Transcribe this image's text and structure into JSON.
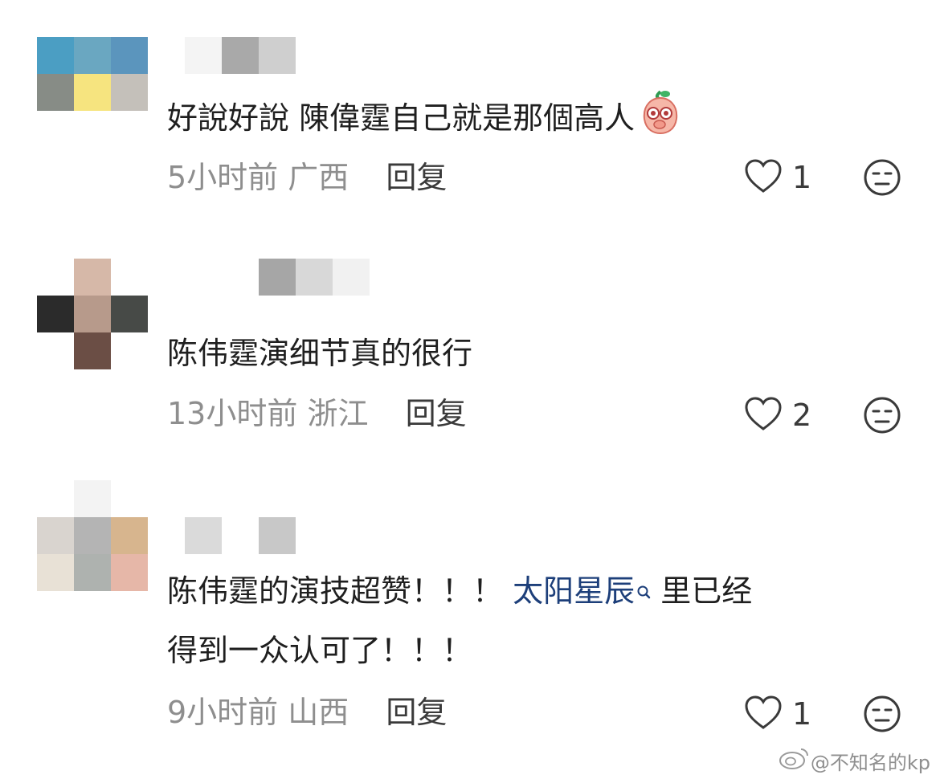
{
  "comments": [
    {
      "text": "好說好說 陳偉霆自己就是那個高人",
      "emoji": "peach-emoji",
      "time": "5小时前",
      "region": "广西",
      "reply_label": "回复",
      "like_count": "1"
    },
    {
      "text": "陈伟霆演细节真的很行",
      "time": "13小时前",
      "region": "浙江",
      "reply_label": "回复",
      "like_count": "2"
    },
    {
      "text_before": "陈伟霆的演技超赞！！！",
      "link_text": "太阳星辰",
      "text_after": "里已经",
      "text_line2": "得到一众认可了！！！",
      "time": "9小时前",
      "region": "山西",
      "reply_label": "回复",
      "like_count": "1"
    }
  ],
  "watermark": "@不知名的kp",
  "icons": {
    "like": "heart-outline-icon",
    "dislike": "unamused-face-icon",
    "search": "search-icon",
    "watermark": "weibo-logo-icon"
  },
  "colors": {
    "link": "#1d3f7a",
    "meta": "#8e8e8e",
    "text": "#1f1f1f"
  }
}
